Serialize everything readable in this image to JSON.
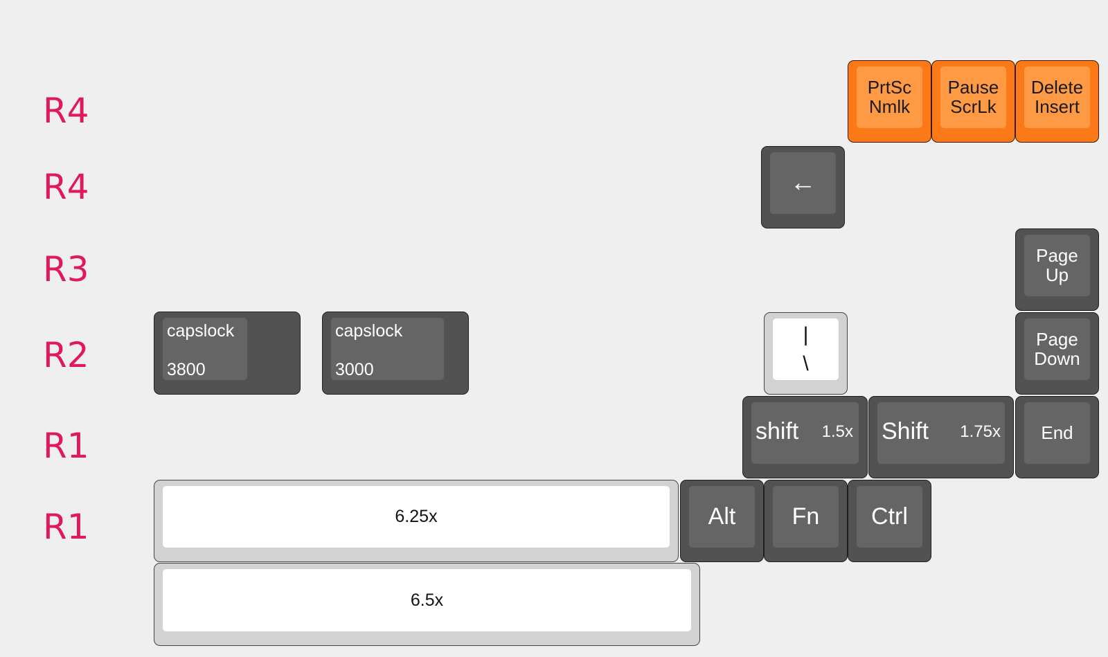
{
  "row_labels": [
    "R4",
    "R4",
    "R3",
    "R2",
    "R1",
    "R1"
  ],
  "colors": {
    "label": "#e0195a",
    "dark_key": "#515251",
    "orange_key": "#fb7a17",
    "white_key": "#ffffff",
    "background": "#efefef"
  },
  "keys": {
    "prtsc": [
      "PrtSc",
      "Nmlk"
    ],
    "pause": [
      "Pause",
      "ScrLk"
    ],
    "delete": [
      "Delete",
      "Insert"
    ],
    "backspace": "←",
    "pageup": [
      "Page",
      "Up"
    ],
    "pagedown": [
      "Page",
      "Down"
    ],
    "end": "End",
    "backslash": [
      "|",
      "\\"
    ],
    "capslock1": {
      "label": "capslock",
      "value": "3800"
    },
    "capslock2": {
      "label": "capslock",
      "value": "3000"
    },
    "shift1": {
      "label": "shift",
      "size": "1.5x"
    },
    "shift2": {
      "label": "Shift",
      "size": "1.75x"
    },
    "alt": "Alt",
    "fn": "Fn",
    "ctrl": "Ctrl",
    "space1": "6.25x",
    "space2": "6.5x"
  }
}
